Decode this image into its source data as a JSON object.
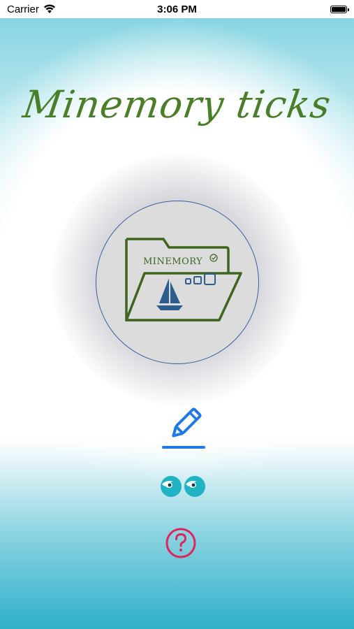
{
  "status_bar": {
    "carrier": "Carrier",
    "time": "3:06 PM"
  },
  "app": {
    "title": "Minemory ticks",
    "logo_text": "MINEMORY"
  },
  "colors": {
    "title_green": "#4a7f2a",
    "folder_green": "#3f6420",
    "logo_ring": "#3b5ea0",
    "pencil_blue": "#1e7be6",
    "eyes_teal": "#1fb3c4",
    "help_red": "#e0245e"
  },
  "icons": {
    "logo": "folder-sailboat-icon",
    "edit": "pencil-icon",
    "view": "eyes-icon",
    "help": "question-mark-icon"
  }
}
